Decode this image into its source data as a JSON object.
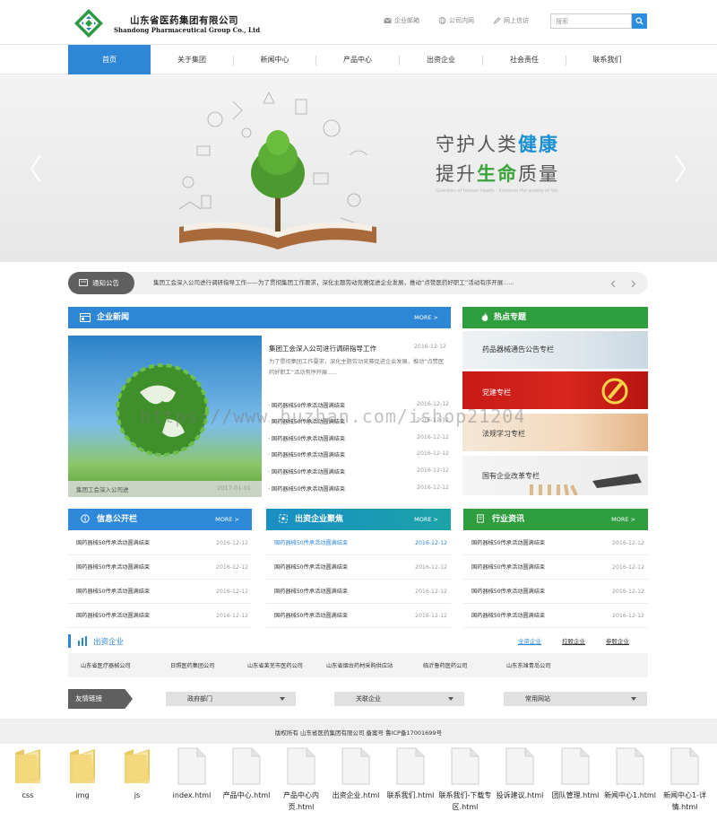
{
  "header": {
    "company_cn": "山东省医药集团有限公司",
    "company_en": "Shandong  Pharmaceutical Group Co., Ltd",
    "links": [
      "企业邮箱",
      "公司内网",
      "网上信访"
    ],
    "search_placeholder": "搜索"
  },
  "nav": [
    "首页",
    "关于集团",
    "新闻中心",
    "产品中心",
    "出资企业",
    "社会责任",
    "联系我们"
  ],
  "banner": {
    "line1_prefix": "守护人类",
    "line1_highlight": "健康",
    "line2_prefix": "提升",
    "line2_highlight": "生命",
    "line2_suffix": "质量",
    "subtitle": "Guardian of human health · Enhance the quality of life"
  },
  "notice": {
    "label": "通知公告",
    "text": "集团工会深入公司进行调研指导工作——为了贯彻集团工作要求，深化主题劳动竞赛促进企业发展，推动“点赞医药好职工”活动有序开展......"
  },
  "news": {
    "title": "企业新闻",
    "more": "MORE >",
    "photo_caption": "集团工会深入公司进",
    "photo_date": "2017-01-01",
    "headline": "集团工会深入公司进行调研指导工作",
    "headline_date": "2016-12-12",
    "summary": "为了贯彻集团工作要求，深化主题劳动竞赛促进企业发展，推动“点赞医药好职工”活动有序开展......",
    "items": [
      {
        "title": "· 国药器械50传承活动圆满结束",
        "date": "2016-12-12"
      },
      {
        "title": "· 国药器械50传承活动圆满结束",
        "date": "2016-12-12"
      },
      {
        "title": "· 国药器械50传承活动圆满结束",
        "date": "2016-12-12"
      },
      {
        "title": "· 国药器械50传承活动圆满结束",
        "date": "2016-12-12"
      },
      {
        "title": "· 国药器械50传承活动圆满结束",
        "date": "2016-12-12"
      },
      {
        "title": "· 国药器械50传承活动圆满结束",
        "date": "2016-12-12"
      }
    ]
  },
  "hot": {
    "title": "热点专题",
    "items": [
      "药品器械通告公告专栏",
      "党建专栏",
      "法规学习专栏",
      "国有企业改革专栏"
    ]
  },
  "panels": [
    {
      "title": "信息公开栏",
      "more": "MORE >",
      "color": "#2e8ad8",
      "rows": [
        {
          "title": "国药器械50传承活动圆满结束",
          "date": "2016-12-12"
        },
        {
          "title": "国药器械50传承活动圆满结束",
          "date": "2016-12-12"
        },
        {
          "title": "国药器械50传承活动圆满结束",
          "date": "2016-12-12"
        },
        {
          "title": "国药器械50传承活动圆满结束",
          "date": "2016-12-12"
        }
      ]
    },
    {
      "title": "出资企业聚焦",
      "more": "MORE >",
      "color": "#1ba3a8",
      "rows": [
        {
          "title": "国药器械50传承活动圆满结束",
          "date": "2016-12-12"
        },
        {
          "title": "国药器械50传承活动圆满结束",
          "date": "2016-12-12"
        },
        {
          "title": "国药器械50传承活动圆满结束",
          "date": "2016-12-12"
        },
        {
          "title": "国药器械50传承活动圆满结束",
          "date": "2016-12-12"
        }
      ]
    },
    {
      "title": "行业资讯",
      "more": "MORE >",
      "color": "#2f9e3f",
      "rows": [
        {
          "title": "国药器械50传承活动圆满结束",
          "date": "2016-12-12"
        },
        {
          "title": "国药器械50传承活动圆满结束",
          "date": "2016-12-12"
        },
        {
          "title": "国药器械50传承活动圆满结束",
          "date": "2016-12-12"
        },
        {
          "title": "国药器械50传承活动圆满结束",
          "date": "2016-12-12"
        }
      ]
    }
  ],
  "invest": {
    "title": "出资企业",
    "tabs": [
      "全资企业",
      "控股企业",
      "参股企业"
    ],
    "companies": [
      "山东省医疗器械公司",
      "日照医药集团公司",
      "山东省莱芜市医药公司",
      "山东省烟台药材采购供应站",
      "临沂鲁药医药公司",
      "山东东潍青岛公司"
    ]
  },
  "friend_links": {
    "label": "友情链接",
    "dropdowns": [
      "政府部门",
      "关联企业",
      "常用网站"
    ]
  },
  "footer": {
    "copyright": "版权所有 山东省医药集团有限公司 备案号 鲁ICP备17001699号"
  },
  "watermark": "https://www.huzhan.com/ishop21204",
  "files": [
    {
      "name": "css",
      "type": "folder"
    },
    {
      "name": "img",
      "type": "folder"
    },
    {
      "name": "js",
      "type": "folder"
    },
    {
      "name": "index.html",
      "type": "file"
    },
    {
      "name": "产品中心.html",
      "type": "file"
    },
    {
      "name": "产品中心内页.html",
      "type": "file"
    },
    {
      "name": "出资企业.html",
      "type": "file"
    },
    {
      "name": "联系我们.html",
      "type": "file"
    },
    {
      "name": "联系我们-下载专区.html",
      "type": "file"
    },
    {
      "name": "投诉建议.html",
      "type": "file"
    },
    {
      "name": "团队管理.html",
      "type": "file"
    },
    {
      "name": "新闻中心1.html",
      "type": "file"
    },
    {
      "name": "新闻中心1-详情.html",
      "type": "file"
    }
  ],
  "colors": {
    "primary_blue": "#2e87d6",
    "teal": "#1ba3a8",
    "green": "#2f9e3f",
    "red": "#d8261e"
  }
}
